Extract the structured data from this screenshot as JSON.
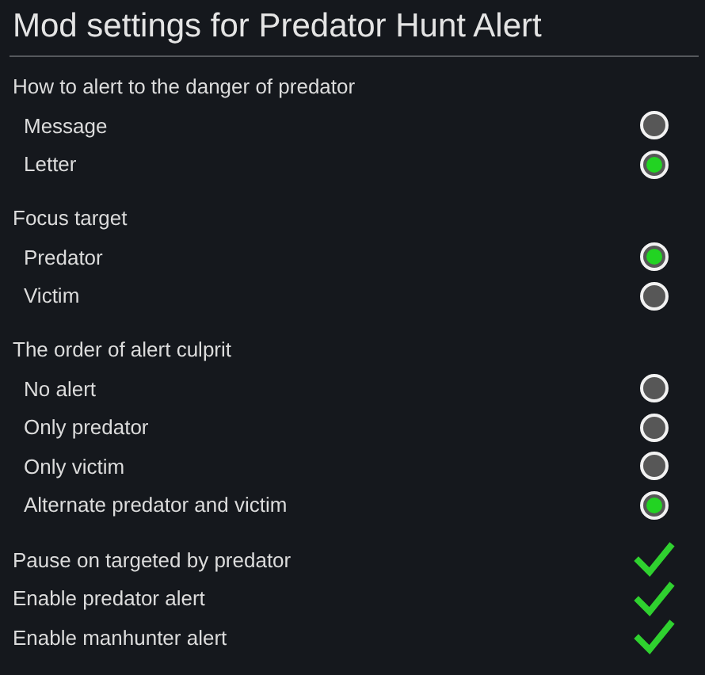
{
  "title": "Mod settings for Predator Hunt Alert",
  "sections": [
    {
      "heading": "How to alert to the danger of predator",
      "options": [
        {
          "label": "Message",
          "selected": false
        },
        {
          "label": "Letter",
          "selected": true
        }
      ]
    },
    {
      "heading": "Focus target",
      "options": [
        {
          "label": "Predator",
          "selected": true
        },
        {
          "label": "Victim",
          "selected": false
        }
      ]
    },
    {
      "heading": "The order of alert culprit",
      "options": [
        {
          "label": "No alert",
          "selected": false
        },
        {
          "label": "Only predator",
          "selected": false
        },
        {
          "label": "Only victim",
          "selected": false
        },
        {
          "label": "Alternate predator and victim",
          "selected": true
        }
      ]
    }
  ],
  "toggles": [
    {
      "label": "Pause on targeted by predator",
      "checked": true
    },
    {
      "label": "Enable predator alert",
      "checked": true
    },
    {
      "label": "Enable manhunter alert",
      "checked": true
    }
  ]
}
